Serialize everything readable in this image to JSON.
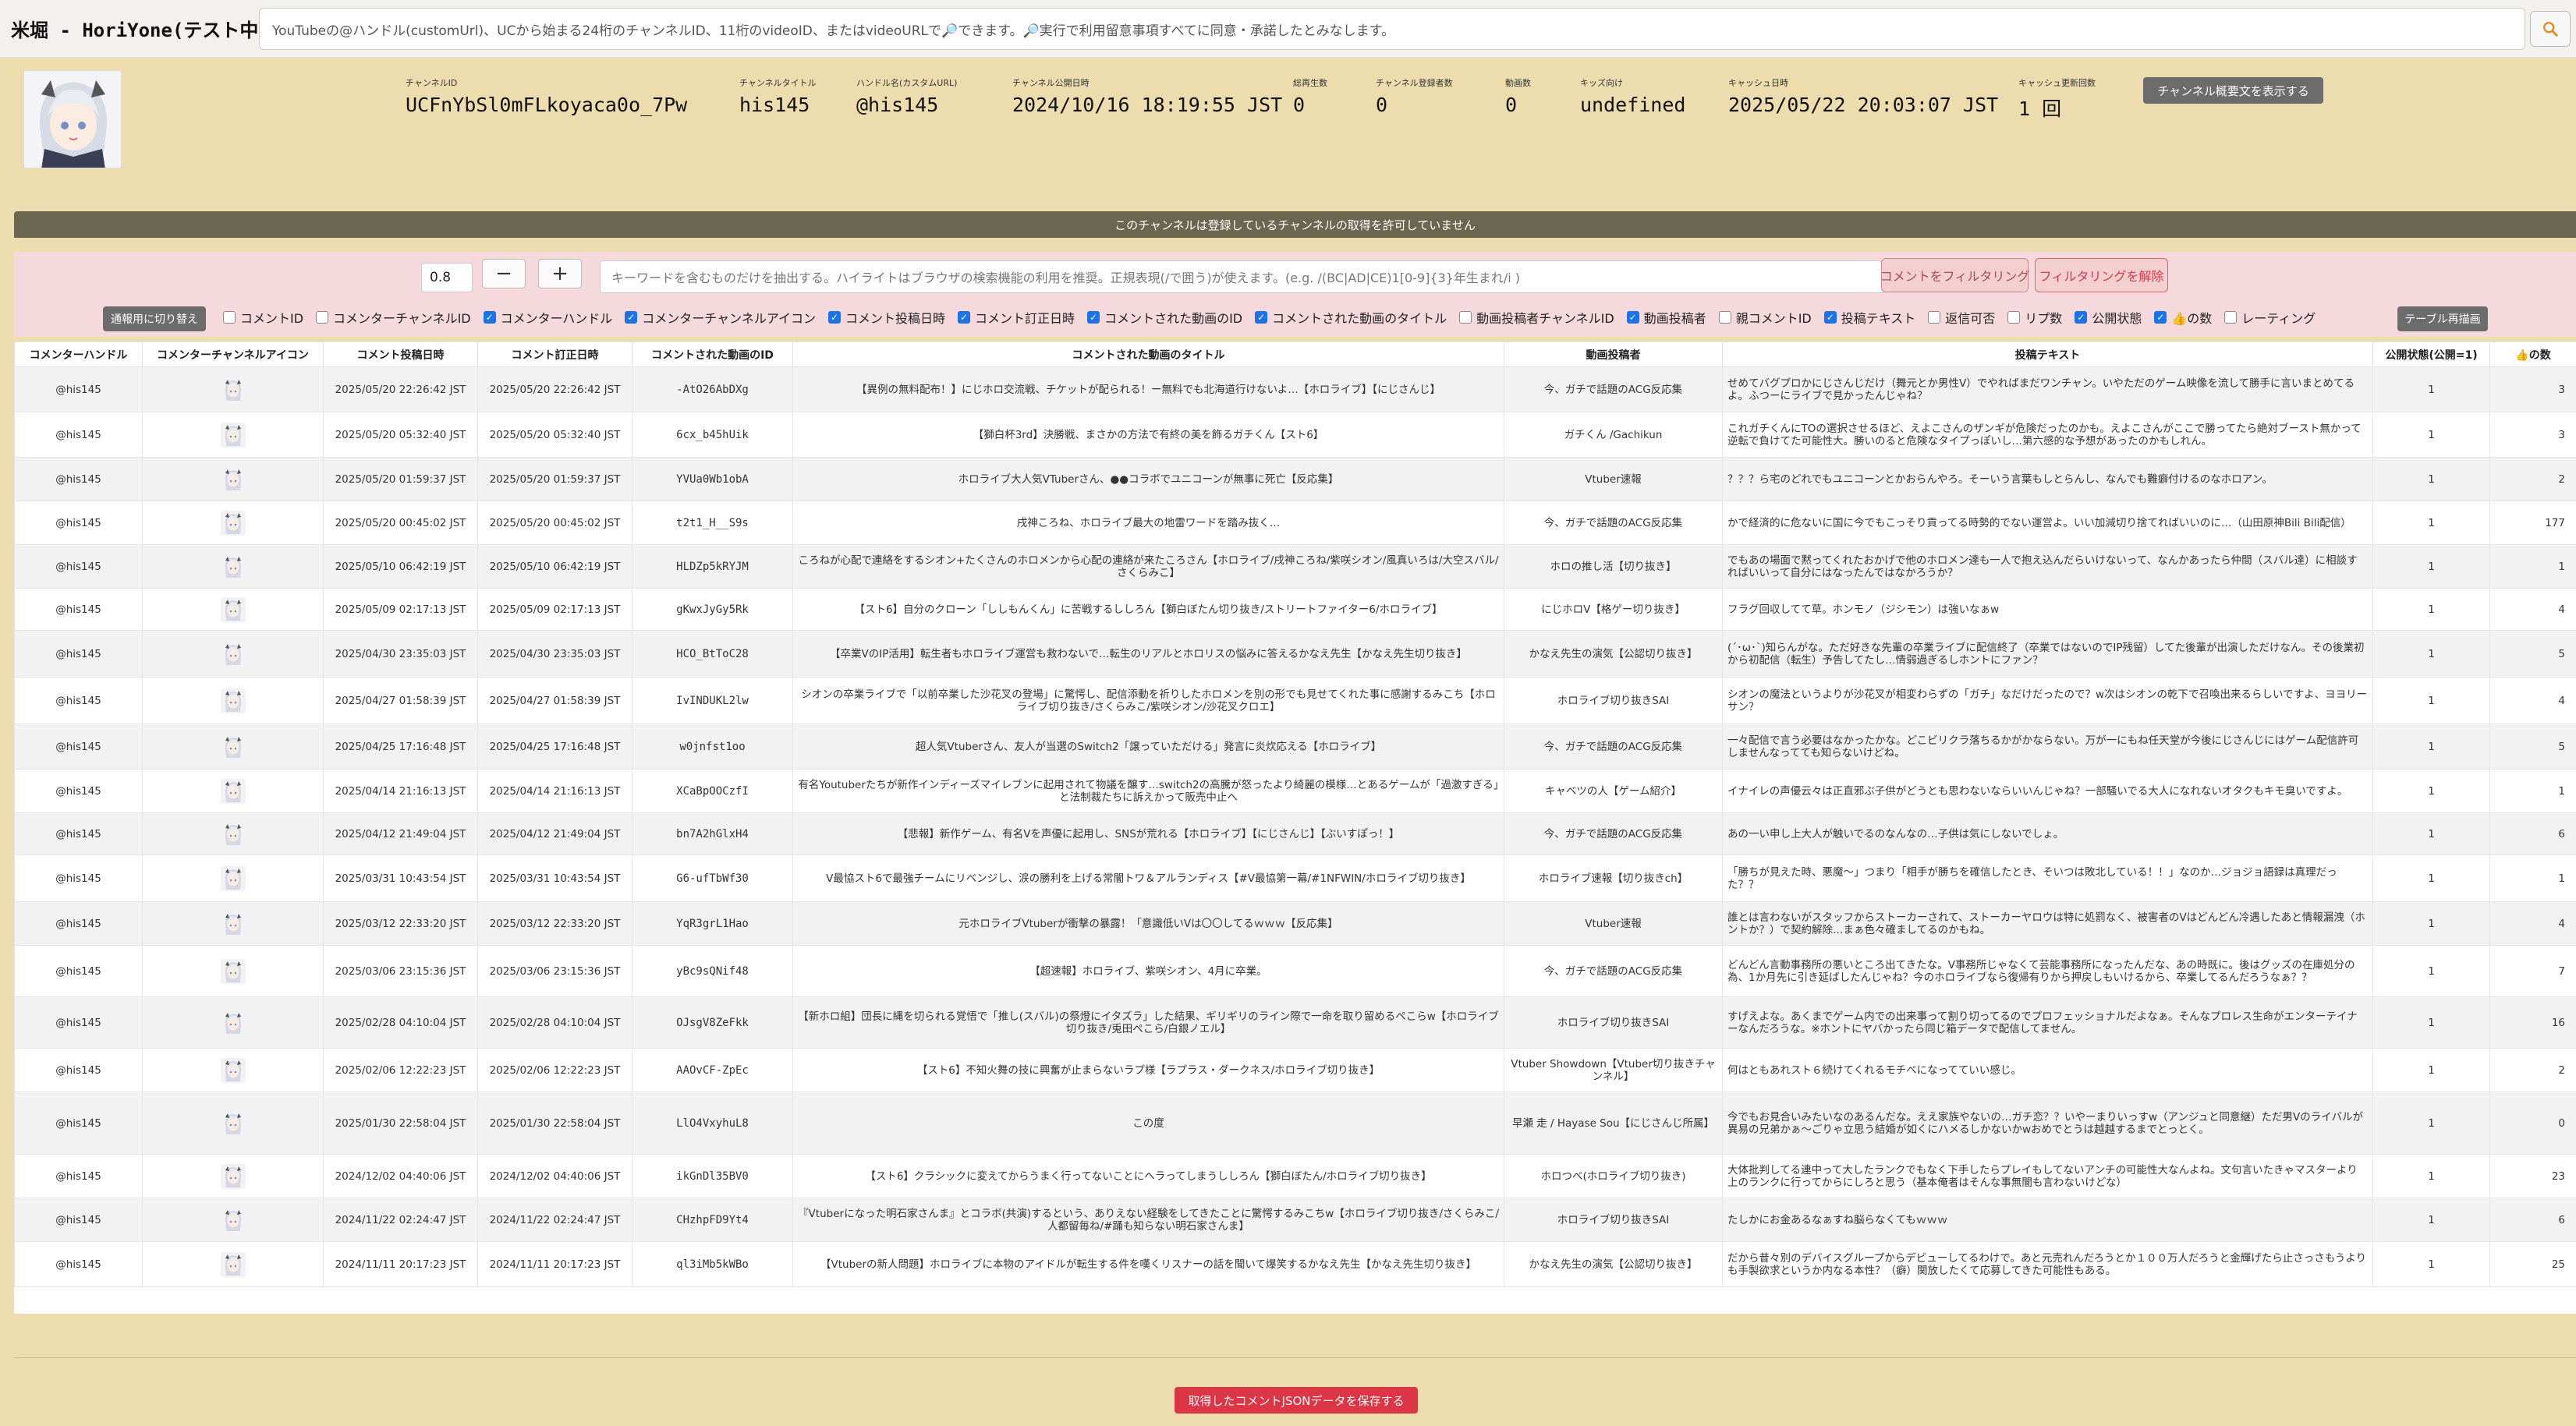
{
  "app": {
    "title": "米堀 - HoriYone(テスト中)"
  },
  "search": {
    "value": "YouTubeの@ハンドル(customUrl)、UCから始まる24桁のチャンネルID、11桁のvideoID、またはvideoURLで🔎できます。🔎実行で利用留意事項すべてに同意・承諾したとみなします。",
    "icon": "search-icon"
  },
  "channel": {
    "fields": [
      {
        "label": "チャンネルID",
        "value": "UCFnYbSl0mFLkoyaca0o_7Pw"
      },
      {
        "label": "チャンネルタイトル",
        "value": "his145"
      },
      {
        "label": "ハンドル名(カスタムURL)",
        "value": "@his145"
      },
      {
        "label": "チャンネル公開日時",
        "value": "2024/10/16 18:19:55 JST"
      },
      {
        "label": "総再生数",
        "value": "0"
      },
      {
        "label": "チャンネル登録者数",
        "value": "0"
      },
      {
        "label": "動画数",
        "value": "0"
      },
      {
        "label": "キッズ向け",
        "value": "undefined"
      },
      {
        "label": "キャッシュ日時",
        "value": "2025/05/22 20:03:07 JST"
      },
      {
        "label": "キャッシュ更新回数",
        "value": "1 回"
      }
    ],
    "desc_button": "チャンネル概要文を表示する"
  },
  "notice": "このチャンネルは登録しているチャンネルの取得を許可していません",
  "filter": {
    "threshold": "0.8",
    "minus": "−",
    "plus": "+",
    "keyword_placeholder": "キーワードを含むものだけを抽出する。ハイライトはブラウザの検索機能の利用を推奨。正規表現(/で囲う)が使えます。(e.g. /(BC|AD|CE)1[0-9]{3}年生まれ/i )",
    "filter_button": "コメントをフィルタリング",
    "unfilter_button": "フィルタリングを解除",
    "switch_button": "通報用に切り替え",
    "redraw_button": "テーブル再描画",
    "toggles": [
      {
        "label": "コメントID",
        "checked": false
      },
      {
        "label": "コメンターチャンネルID",
        "checked": false
      },
      {
        "label": "コメンターハンドル",
        "checked": true
      },
      {
        "label": "コメンターチャンネルアイコン",
        "checked": true
      },
      {
        "label": "コメント投稿日時",
        "checked": true
      },
      {
        "label": "コメント訂正日時",
        "checked": true
      },
      {
        "label": "コメントされた動画のID",
        "checked": true
      },
      {
        "label": "コメントされた動画のタイトル",
        "checked": true
      },
      {
        "label": "動画投稿者チャンネルID",
        "checked": false
      },
      {
        "label": "動画投稿者",
        "checked": true
      },
      {
        "label": "親コメントID",
        "checked": false
      },
      {
        "label": "投稿テキスト",
        "checked": true
      },
      {
        "label": "返信可否",
        "checked": false
      },
      {
        "label": "リプ数",
        "checked": false
      },
      {
        "label": "公開状態",
        "checked": true
      },
      {
        "label": "👍の数",
        "checked": true
      },
      {
        "label": "レーティング",
        "checked": false
      }
    ]
  },
  "table": {
    "headers": [
      "コメンターハンドル",
      "コメンターチャンネルアイコン",
      "コメント投稿日時",
      "コメント訂正日時",
      "コメントされた動画のID",
      "コメントされた動画のタイトル",
      "動画投稿者",
      "投稿テキスト",
      "公開状態(公開=1)",
      "👍の数"
    ],
    "rows": [
      [
        "@his145",
        "2025/05/20 22:26:42 JST",
        "2025/05/20 22:26:42 JST",
        "-AtO26AbDXg",
        "【異例の無料配布！】にじホロ交流戦、チケットが配られる！ー無料でも北海道行けないよ…【ホロライブ】【にじさんじ】",
        "今、ガチで話題のACG反応集",
        "せめてバグプロかにじさんじだけ（舞元とか男性V）でやればまだワンチャン。いやただのゲーム映像を流して勝手に言いまとめてるよ。ふつーにライブで見かったんじゃね？",
        "1",
        "3"
      ],
      [
        "@his145",
        "2025/05/20 05:32:40 JST",
        "2025/05/20 05:32:40 JST",
        "6cx_b45hUik",
        "【獅白杯3rd】決勝戦、まさかの方法で有終の美を飾るガチくん【スト6】",
        "ガチくん /Gachikun",
        "これガチくんにTOの選択させるほど、えよこさんのザンギが危険だったのかも。えよこさんがここで勝ってたら絶対ブースト無かって逆転で負けてた可能性大。勝いのると危険なタイプっぽいし…第六感的な予想があったのかもしれん。",
        "1",
        "3"
      ],
      [
        "@his145",
        "2025/05/20 01:59:37 JST",
        "2025/05/20 01:59:37 JST",
        "YVUa0Wb1obA",
        "ホロライブ大人気VTuberさん、●●コラボでユニコーンが無事に死亡【反応集】",
        "Vtuber速報",
        "？？？ら宅のどれでもユニコーンとかおらんやろ。そーいう言葉もしとらんし、なんでも難癖付けるのなホロアン。",
        "1",
        "2"
      ],
      [
        "@his145",
        "2025/05/20 00:45:02 JST",
        "2025/05/20 00:45:02 JST",
        "t2t1_H__S9s",
        "戌神ころね、ホロライブ最大の地雷ワードを踏み抜く…",
        "今、ガチで話題のACG反応集",
        "かで経済的に危ないに国に今でもこっそり貢ってる時勢的でない運営よ。いい加減切り捨てればいいのに…（山田原神Bili Bili配信）",
        "1",
        "177"
      ],
      [
        "@his145",
        "2025/05/10 06:42:19 JST",
        "2025/05/10 06:42:19 JST",
        "HLDZp5kRYJM",
        "ころねが心配で連絡をするシオン+たくさんのホロメンから心配の連絡が来たころさん【ホロライブ/戌神ころね/紫咲シオン/風真いろは/大空スバル/さくらみこ】",
        "ホロの推し活【切り抜き】",
        "でもあの場面で黙ってくれたおかげで他のホロメン達も一人で抱え込んだらいけないって、なんかあったら仲間（スバル達）に相談すればいいって自分にはなったんではなかろうか？",
        "1",
        "1"
      ],
      [
        "@his145",
        "2025/05/09 02:17:13 JST",
        "2025/05/09 02:17:13 JST",
        "gKwxJyGy5Rk",
        "【スト6】自分のクローン「ししもんくん」に苦戦するししろん【獅白ぼたん切り抜き/ストリートファイター6/ホロライブ】",
        "にじホロV【格ゲー切り抜き】",
        "フラグ回収してて草。ホンモノ（ジシモン）は強いなぁw",
        "1",
        "4"
      ],
      [
        "@his145",
        "2025/04/30 23:35:03 JST",
        "2025/04/30 23:35:03 JST",
        "HCO_BtToC28",
        "【卒業VのIP活用】転生者もホロライブ運営も救わないで…転生のリアルとホロリスの悩みに答えるかなえ先生【かなえ先生切り抜き】",
        "かなえ先生の演気【公認切り抜き】",
        "(´･ω･`)知らんがな。ただ好きな先輩の卒業ライブに配信終了（卒業ではないのでIP残留）してた後輩が出演しただけなん。その後業初から初配信（転生）予告してたし…情弱過ぎるしホントにファン？",
        "1",
        "5"
      ],
      [
        "@his145",
        "2025/04/27 01:58:39 JST",
        "2025/04/27 01:58:39 JST",
        "IvINDUKL2lw",
        "シオンの卒業ライブで「以前卒業した沙花叉の登場」に驚愕し、配信添動を祈りしたホロメンを別の形でも見せてくれた事に感謝するみこち【ホロライブ切り抜き/さくらみこ/紫咲シオン/沙花叉クロエ】",
        "ホロライブ切り抜きSAI",
        "シオンの魔法というよりが沙花叉が相変わらずの「ガチ」なだけだったので？w次はシオンの乾下で召喚出来るらしいですよ、ヨヨリーサン？",
        "1",
        "4"
      ],
      [
        "@his145",
        "2025/04/25 17:16:48 JST",
        "2025/04/25 17:16:48 JST",
        "w0jnfst1oo",
        "超人気Vtuberさん、友人が当選のSwitch2「譲っていただける」発言に炎炊応える【ホロライブ】",
        "今、ガチで話題のACG反応集",
        "一々配信で言う必要はなかったかな。どこビリクラ落ちるかがかならない。万が一にもね任天堂が今後にじさんじにはゲーム配信許可しませんなってても知らないけどね。",
        "1",
        "5"
      ],
      [
        "@his145",
        "2025/04/14 21:16:13 JST",
        "2025/04/14 21:16:13 JST",
        "XCaBpOOCzfI",
        "有名Youtuberたちが新作インディーズマイレブンに起用されて物議を醸す…switch2の高騰が怒ったより綺麗の模様…とあるゲームが「過激すぎる」と法制裁たちに訴えかって販売中止へ",
        "キャベツの人【ゲーム紹介】",
        "イナイレの声優云々は正直邪ぶ子供がどうとも思わないならいいんじゃね？一部騒いでる大人になれないオタクもキモ臭いですよ。",
        "1",
        "1"
      ],
      [
        "@his145",
        "2025/04/12 21:49:04 JST",
        "2025/04/12 21:49:04 JST",
        "bn7A2hGlxH4",
        "【悲報】新作ゲーム、有名Vを声優に起用し、SNSが荒れる【ホロライブ】【にじさんじ】【ぶいすぽっ！】",
        "今、ガチで話題のACG反応集",
        "あの一い申し上大人が触いでるのなんなの…子供は気にしないでしょ。",
        "1",
        "6"
      ],
      [
        "@his145",
        "2025/03/31 10:43:54 JST",
        "2025/03/31 10:43:54 JST",
        "G6-ufTbWf30",
        "V最協スト6で最強チームにリベンジし、涙の勝利を上げる常闇トワ＆アルランディス【#V最協第一幕/#1NFWIN/ホロライブ切り抜き】",
        "ホロライブ速報【切り抜きch】",
        "「勝ちが見えた時、悪魔～」つまり「相手が勝ちを確信したとき、そいつは敗北している！！」なのか…ジョジョ語録は真理だった？？",
        "1",
        "1"
      ],
      [
        "@his145",
        "2025/03/12 22:33:20 JST",
        "2025/03/12 22:33:20 JST",
        "YqR3grL1Hao",
        "元ホロライブVtuberが衝撃の暴露！「意識低いVは〇〇してるｗｗｗ【反応集】",
        "Vtuber速報",
        "誰とは言わないがスタッフからストーカーされて、ストーカーヤロウは特に処罰なく、被害者のVはどんどん冷遇したあと情報漏洩（ホントか？）で契約解除…まぁ色々確ましてるのかもね。",
        "1",
        "4"
      ],
      [
        "@his145",
        "2025/03/06 23:15:36 JST",
        "2025/03/06 23:15:36 JST",
        "yBc9sQNif48",
        "【超速報】ホロライブ、紫咲シオン、4月に卒業。",
        "今、ガチで話題のACG反応集",
        "どんどん言動事務所の悪いところ出てきたな。V事務所じゃなくて芸能事務所になったんだな、あの時既に。後はグッズの在庫処分の為、1か月先に引き延ばしたんじゃね？今のホロライブなら復帰有りから押戻しもいけるから、卒業してるんだろうなぁ？？",
        "1",
        "7"
      ],
      [
        "@his145",
        "2025/02/28 04:10:04 JST",
        "2025/02/28 04:10:04 JST",
        "OJsgV8ZeFkk",
        "【新ホロ組】団長に縄を切られる覚悟で「推し(スバル)の祭燈にイタズラ」した結果、ギリギリのライン際で一命を取り留めるぺこらw【ホロライブ切り抜き/兎田ぺこら/白銀ノエル】",
        "ホロライブ切り抜きSAI",
        "すげえよな。あくまでゲーム内での出来事って割り切ってるのでプロフェッショナルだよなぁ。そんなプロレス生命がエンターテイナーなんだろうな。※ホントにヤバかったら同じ箱データで配信してません。",
        "1",
        "16"
      ],
      [
        "@his145",
        "2025/02/06 12:22:23 JST",
        "2025/02/06 12:22:23 JST",
        "AAOvCF-ZpEc",
        "【スト6】不知火舞の技に興奮が止まらないラプ様【ラプラス・ダークネス/ホロライブ切り抜き】",
        "Vtuber Showdown【Vtuber切り抜きチャンネル】",
        "何はともあれスト６続けてくれるモチベになってていい感じ。",
        "1",
        "2"
      ],
      [
        "@his145",
        "2025/01/30 22:58:04 JST",
        "2025/01/30 22:58:04 JST",
        "LlO4VxyhuL8",
        "この度",
        "早瀬 走 / Hayase Sou【にじさんじ所属】",
        "今でもお見合いみたいなのあるんだな。ええ家族やないの…ガチ恋？？いやーまりいっすw（アンジュと同意継）ただ男Vのライバルが異易の兄弟かぁ～ごりゃ立思う結婚が如くにハメるしかないかwおめでとうは越越するまでとっとく。",
        "1",
        "0"
      ],
      [
        "@his145",
        "2024/12/02 04:40:06 JST",
        "2024/12/02 04:40:06 JST",
        "ikGnDl35BV0",
        "【スト6】クラシックに変えてからうまく行ってないことにヘラってしまうししろん【獅白ぼたん/ホロライブ切り抜き】",
        "ホロつべ(ホロライブ切り抜き)",
        "大体批判してる連中って大したランクでもなく下手したらプレイもしてないアンチの可能性大なんよね。文句言いたきゃマスターより上のランクに行ってからにしろと思う（基本俺者はそんな事無闇も言わないけどな）",
        "1",
        "23"
      ],
      [
        "@his145",
        "2024/11/22 02:24:47 JST",
        "2024/11/22 02:24:47 JST",
        "CHzhpFD9Yt4",
        "『Vtuberになった明石家さんま』とコラボ(共演)するという、ありえない経験をしてきたことに驚愕するみこちw【ホロライブ切り抜き/さくらみこ/人都留毎ね/#踊も知らない明石家さんま】",
        "ホロライブ切り抜きSAI",
        "たしかにお金あるなぁすね脳らなくてもｗｗｗ",
        "1",
        "6"
      ],
      [
        "@his145",
        "2024/11/11 20:17:23 JST",
        "2024/11/11 20:17:23 JST",
        "ql3iMb5kWBo",
        "【Vtuberの新人問題】ホロライブに本物のアイドルが転生する件を嘆くリスナーの話を聞いて爆笑するかなえ先生【かなえ先生切り抜き】",
        "かなえ先生の演気【公認切り抜き】",
        "だから昔々別のデバイスグループからデビューしてるわけで。あと元売れんだろうとか１００万人だろうと金輝げたら止さっさもうよりも手製欲求というか内なる本性？（癖）関放したくて応募してきた可能性もある。",
        "1",
        "25"
      ]
    ]
  },
  "save_button": "取得したコメントJSONデータを保存する"
}
